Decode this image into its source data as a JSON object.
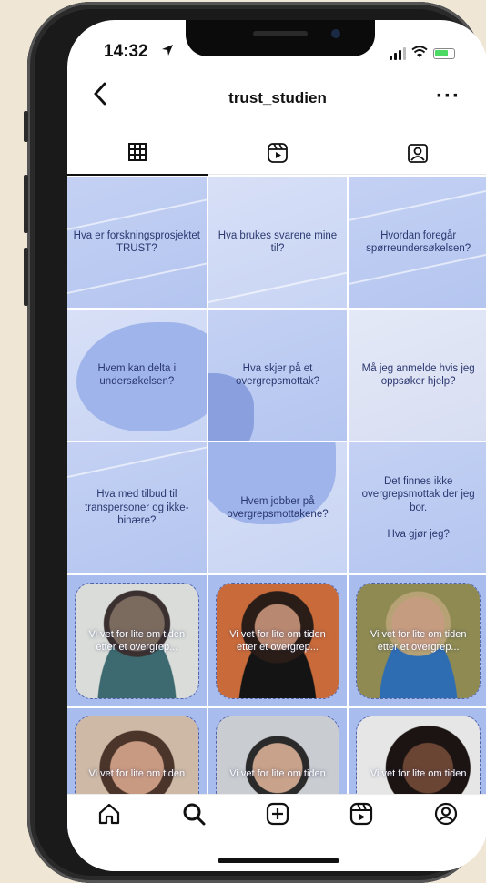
{
  "status": {
    "time": "14:32"
  },
  "header": {
    "title": "trust_studien",
    "back_icon": "chevron-left-icon",
    "more_label": "···"
  },
  "tabs": [
    {
      "name": "grid",
      "icon": "grid-icon",
      "active": true
    },
    {
      "name": "reels",
      "icon": "reels-icon",
      "active": false
    },
    {
      "name": "tagged",
      "icon": "tagged-user-icon",
      "active": false
    }
  ],
  "posts": [
    {
      "text": "Hva er forskningsprosjektet TRUST?"
    },
    {
      "text": "Hva brukes svarene mine til?"
    },
    {
      "text": "Hvordan foregår spørreundersøkelsen?"
    },
    {
      "text": "Hvem kan delta i undersøkelsen?"
    },
    {
      "text": "Hva skjer på et overgrepsmottak?"
    },
    {
      "text": "Må jeg anmelde hvis jeg oppsøker hjelp?"
    },
    {
      "text": "Hva med tilbud til transpersoner og ikke-binære?"
    },
    {
      "text": "Hvem jobber på overgrepsmottakene?"
    },
    {
      "text": "Det finnes ikke overgrepsmottak der jeg bor.\n\nHva gjør jeg?"
    },
    {
      "text": "Vi vet for lite om tiden etter et overgrep..."
    },
    {
      "text": "Vi vet for lite om tiden etter et overgrep..."
    },
    {
      "text": "Vi vet for lite om tiden etter et overgrep..."
    },
    {
      "text": "Vi vet for lite om tiden"
    },
    {
      "text": "Vi vet for lite om tiden"
    },
    {
      "text": "Vi vet for lite om tiden"
    }
  ],
  "colors": {
    "accent": "#b4c5ef",
    "text": "#2b3870"
  },
  "bottom_nav": [
    {
      "icon": "home-icon"
    },
    {
      "icon": "search-icon"
    },
    {
      "icon": "create-post-icon"
    },
    {
      "icon": "reels-icon"
    },
    {
      "icon": "profile-icon"
    }
  ]
}
